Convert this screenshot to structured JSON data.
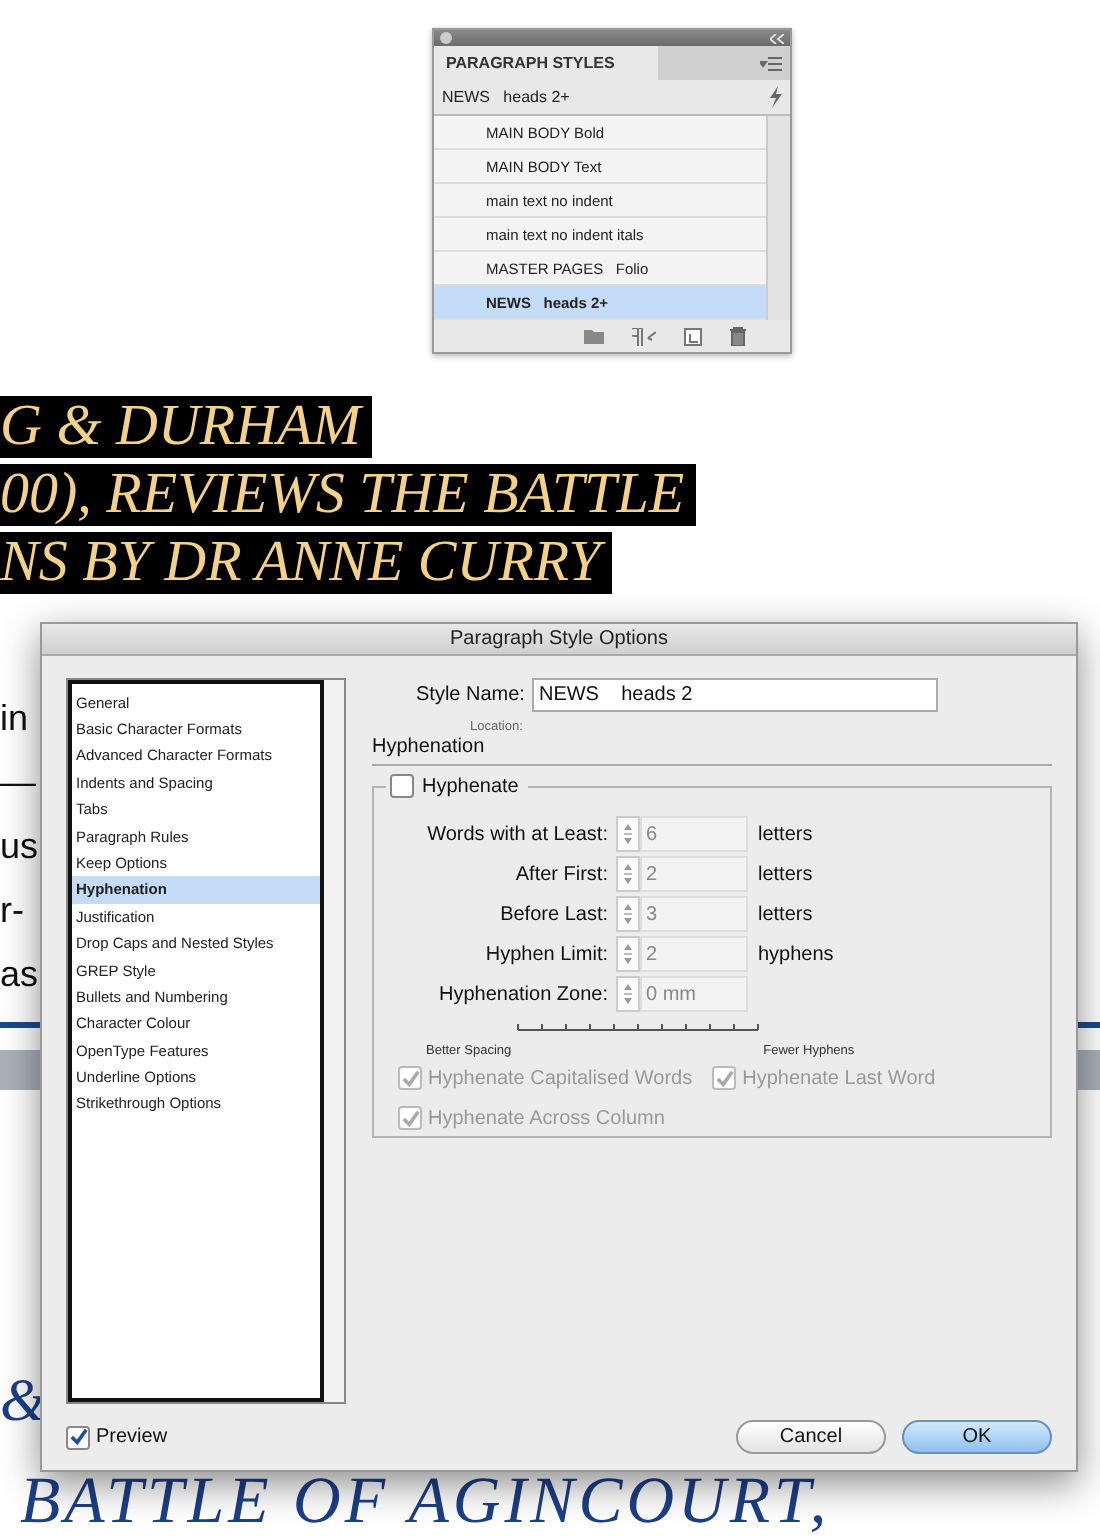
{
  "panel": {
    "title": "PARAGRAPH STYLES",
    "current_style": "NEWS   heads 2+",
    "styles": [
      {
        "label": "MAIN BODY Bold",
        "selected": false
      },
      {
        "label": "MAIN BODY Text",
        "selected": false
      },
      {
        "label": "main text no indent",
        "selected": false
      },
      {
        "label": "main text no indent itals",
        "selected": false
      },
      {
        "label": "MASTER PAGES   Folio",
        "selected": false
      },
      {
        "label": "NEWS   heads 2+",
        "selected": true
      }
    ]
  },
  "document": {
    "headline_lines": [
      "G & DURHAM",
      "00), REVIEWS THE BATTLE",
      "NS BY DR ANNE CURRY"
    ],
    "body_fragments": [
      "in",
      "—",
      "us",
      "r-",
      "as"
    ],
    "ampersand": "&",
    "subhead": "BATTLE OF AGINCOURT,"
  },
  "dialog": {
    "title": "Paragraph Style Options",
    "categories": [
      {
        "label": "General",
        "selected": false
      },
      {
        "label": "Basic Character Formats",
        "selected": false
      },
      {
        "label": "Advanced Character Formats",
        "selected": false
      },
      {
        "label": "Indents and Spacing",
        "selected": false
      },
      {
        "label": "Tabs",
        "selected": false
      },
      {
        "label": "Paragraph Rules",
        "selected": false
      },
      {
        "label": "Keep Options",
        "selected": false
      },
      {
        "label": "Hyphenation",
        "selected": true
      },
      {
        "label": "Justification",
        "selected": false
      },
      {
        "label": "Drop Caps and Nested Styles",
        "selected": false
      },
      {
        "label": "GREP Style",
        "selected": false
      },
      {
        "label": "Bullets and Numbering",
        "selected": false
      },
      {
        "label": "Character Colour",
        "selected": false
      },
      {
        "label": "OpenType Features",
        "selected": false
      },
      {
        "label": "Underline Options",
        "selected": false
      },
      {
        "label": "Strikethrough Options",
        "selected": false
      }
    ],
    "style_name_label": "Style Name:",
    "style_name": "NEWS    heads 2",
    "location_label": "Location:",
    "section": "Hyphenation",
    "hyphenate": {
      "label": "Hyphenate",
      "checked": false
    },
    "fields": [
      {
        "label": "Words with at Least:",
        "value": "6",
        "unit": "letters",
        "disabled": true
      },
      {
        "label": "After First:",
        "value": "2",
        "unit": "letters",
        "disabled": true
      },
      {
        "label": "Before Last:",
        "value": "3",
        "unit": "letters",
        "disabled": true
      },
      {
        "label": "Hyphen Limit:",
        "value": "2",
        "unit": "hyphens",
        "disabled": true
      },
      {
        "label": "Hyphenation Zone:",
        "value": "0 mm",
        "disabled": true
      }
    ],
    "scale": {
      "left_label": "Better Spacing",
      "right_label": "Fewer Hyphens"
    },
    "options": [
      {
        "label": "Hyphenate Capitalised Words",
        "checked": true,
        "disabled": true
      },
      {
        "label": "Hyphenate Last Word",
        "checked": true,
        "disabled": true
      },
      {
        "label": "Hyphenate Across Column",
        "checked": true,
        "disabled": true
      }
    ],
    "preview": {
      "label": "Preview",
      "checked": true
    },
    "buttons": [
      {
        "label": "Cancel",
        "kind": "secondary"
      },
      {
        "label": "OK",
        "kind": "default"
      }
    ]
  }
}
